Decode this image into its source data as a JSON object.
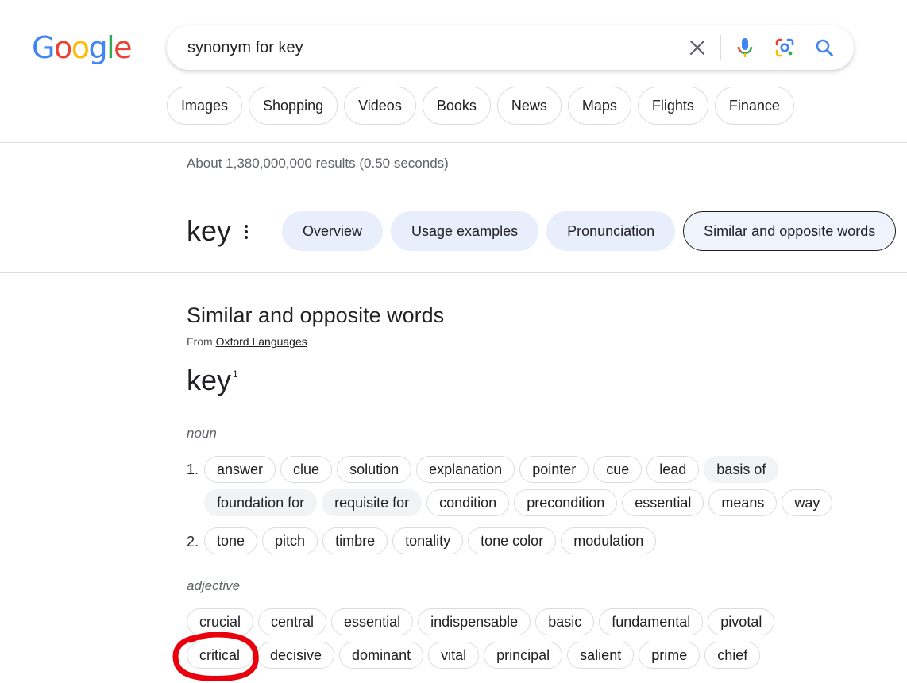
{
  "logo": {
    "letters": [
      {
        "char": "G",
        "color": "#4285F4"
      },
      {
        "char": "o",
        "color": "#EA4335"
      },
      {
        "char": "o",
        "color": "#FBBC05"
      },
      {
        "char": "g",
        "color": "#4285F4"
      },
      {
        "char": "l",
        "color": "#34A853"
      },
      {
        "char": "e",
        "color": "#EA4335"
      }
    ]
  },
  "search": {
    "query": "synonym for key",
    "icons": [
      "clear-icon",
      "mic-icon",
      "lens-icon",
      "search-icon"
    ]
  },
  "filters": [
    "Images",
    "Shopping",
    "Videos",
    "Books",
    "News",
    "Maps",
    "Flights",
    "Finance"
  ],
  "result_stats": "About 1,380,000,000 results (0.50 seconds)",
  "term": "key",
  "tabs": [
    {
      "label": "Overview",
      "active": false
    },
    {
      "label": "Usage examples",
      "active": false
    },
    {
      "label": "Pronunciation",
      "active": false
    },
    {
      "label": "Similar and opposite words",
      "active": true
    }
  ],
  "section": {
    "title": "Similar and opposite words",
    "source_prefix": "From",
    "source_link": "Oxford Languages",
    "headword": "key",
    "headword_sup": "1"
  },
  "noun": {
    "label": "noun",
    "senses": [
      {
        "num": "1.",
        "rows": [
          [
            {
              "t": "answer",
              "s": false
            },
            {
              "t": "clue",
              "s": false
            },
            {
              "t": "solution",
              "s": false
            },
            {
              "t": "explanation",
              "s": false
            },
            {
              "t": "pointer",
              "s": false
            },
            {
              "t": "cue",
              "s": false
            },
            {
              "t": "lead",
              "s": false
            },
            {
              "t": "basis of",
              "s": true
            }
          ],
          [
            {
              "t": "foundation for",
              "s": true
            },
            {
              "t": "requisite for",
              "s": true
            },
            {
              "t": "condition",
              "s": false
            },
            {
              "t": "precondition",
              "s": false
            },
            {
              "t": "essential",
              "s": false
            },
            {
              "t": "means",
              "s": false
            },
            {
              "t": "way",
              "s": false
            }
          ]
        ]
      },
      {
        "num": "2.",
        "rows": [
          [
            {
              "t": "tone",
              "s": false
            },
            {
              "t": "pitch",
              "s": false
            },
            {
              "t": "timbre",
              "s": false
            },
            {
              "t": "tonality",
              "s": false
            },
            {
              "t": "tone color",
              "s": false
            },
            {
              "t": "modulation",
              "s": false
            }
          ]
        ]
      }
    ]
  },
  "adjective": {
    "label": "adjective",
    "rows": [
      [
        {
          "t": "crucial",
          "s": false
        },
        {
          "t": "central",
          "s": false
        },
        {
          "t": "essential",
          "s": false
        },
        {
          "t": "indispensable",
          "s": false
        },
        {
          "t": "basic",
          "s": false
        },
        {
          "t": "fundamental",
          "s": false
        },
        {
          "t": "pivotal",
          "s": false
        }
      ],
      [
        {
          "t": "critical",
          "s": false
        },
        {
          "t": "decisive",
          "s": false
        },
        {
          "t": "dominant",
          "s": false
        },
        {
          "t": "vital",
          "s": false
        },
        {
          "t": "principal",
          "s": false
        },
        {
          "t": "salient",
          "s": false
        },
        {
          "t": "prime",
          "s": false
        },
        {
          "t": "chief",
          "s": false
        }
      ]
    ]
  },
  "annotation": {
    "highlight_color": "#E8000D"
  }
}
